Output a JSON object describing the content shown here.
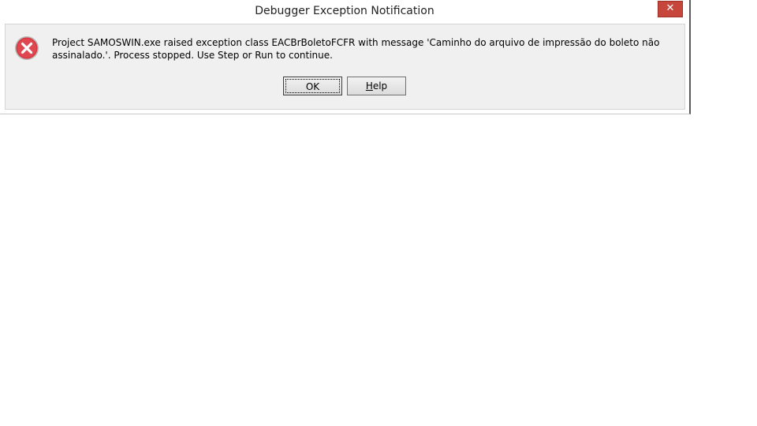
{
  "window": {
    "title": "Debugger Exception Notification",
    "close_glyph": "✕"
  },
  "message": {
    "text": "Project SAMOSWIN.exe raised exception class EACBrBoletoFCFR with message 'Caminho do arquivo de impressão do boleto não assinalado.'. Process stopped. Use Step or Run to continue.",
    "icon": "error-icon"
  },
  "buttons": {
    "ok_label": "OK",
    "help_mnemonic": "H",
    "help_rest": "elp"
  },
  "colors": {
    "close_button": "#c7463c",
    "error_icon": "#d9363e"
  }
}
